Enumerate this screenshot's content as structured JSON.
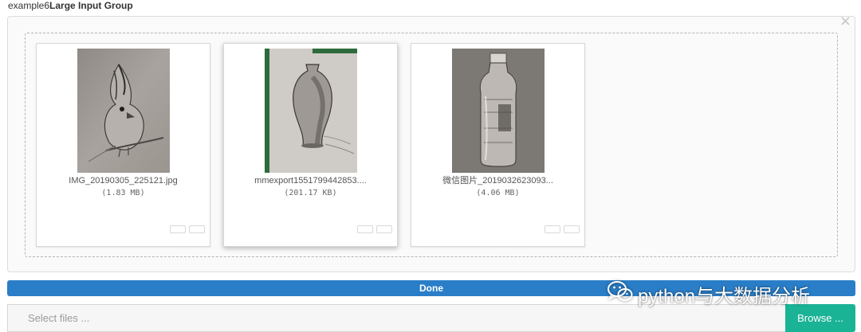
{
  "example_title": {
    "prefix": "example6",
    "bold": "Large Input Group"
  },
  "panel": {
    "close_icon": "close-icon",
    "close_label": "×"
  },
  "files": [
    {
      "name": "IMG_20190305_225121.jpg",
      "size": "(1.83 MB)",
      "icon": "bird-sketch-thumbnail"
    },
    {
      "name": "mmexport1551799442853....",
      "size": "(201.17 KB)",
      "icon": "vase-sketch-thumbnail"
    },
    {
      "name": "微信图片_2019032623093...",
      "size": "(4.06 MB)",
      "icon": "bottle-sketch-thumbnail"
    }
  ],
  "progress": {
    "label": "Done",
    "percent": 100,
    "color": "#2a7ec8"
  },
  "input_group": {
    "placeholder": "Select files ...",
    "browse_label": "Browse ...",
    "browse_color": "#1ab395"
  },
  "watermark": {
    "text": "python与大数据分析",
    "icon": "wechat-icon"
  }
}
